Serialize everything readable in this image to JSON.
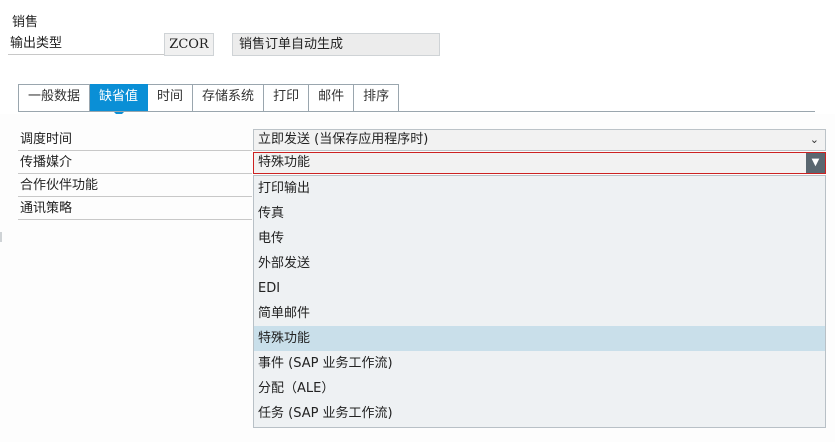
{
  "header": {
    "group_label": "销售",
    "output_type_label": "输出类型",
    "output_type_code": "ZCOR",
    "output_type_desc": "销售订单自动生成"
  },
  "tabs": [
    {
      "label": "一般数据",
      "active": false
    },
    {
      "label": "缺省值",
      "active": true
    },
    {
      "label": "时间",
      "active": false
    },
    {
      "label": "存储系统",
      "active": false
    },
    {
      "label": "打印",
      "active": false
    },
    {
      "label": "邮件",
      "active": false
    },
    {
      "label": "排序",
      "active": false
    }
  ],
  "fields": {
    "dispatch_time": {
      "label": "调度时间",
      "value": "立即发送 (当保存应用程序时)"
    },
    "medium": {
      "label": "传播媒介",
      "value": "特殊功能"
    },
    "partner_function": {
      "label": "合作伙伴功能"
    },
    "comm_strategy": {
      "label": "通讯策略"
    }
  },
  "dropdown": {
    "options": [
      "打印输出",
      "传真",
      "电传",
      "外部发送",
      "EDI",
      "简单邮件",
      "特殊功能",
      "事件 (SAP 业务工作流)",
      "分配（ALE）",
      "任务 (SAP 业务工作流)"
    ],
    "selected_index": 6
  },
  "colors": {
    "active_tab": "#0a8fd6",
    "selected_option": "#c9dfea",
    "focus_border": "#cc2222"
  },
  "icons": {
    "dispatch_chevron": "chevron-down-icon",
    "medium_toggle": "dropdown-toggle-icon"
  }
}
